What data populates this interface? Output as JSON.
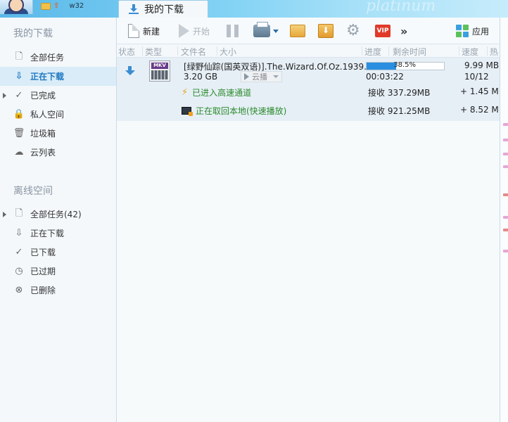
{
  "header": {
    "username": "w32",
    "active_tab": "我的下载",
    "watermark": "platinum"
  },
  "sidebar": {
    "my_downloads_title": "我的下载",
    "my_items": [
      {
        "label": "全部任务",
        "icon": "file-icon"
      },
      {
        "label": "正在下载",
        "icon": "download-icon",
        "active": true
      },
      {
        "label": "已完成",
        "icon": "check-icon",
        "expandable": true
      },
      {
        "label": "私人空间",
        "icon": "lock-icon"
      },
      {
        "label": "垃圾箱",
        "icon": "trash-icon"
      },
      {
        "label": "云列表",
        "icon": "cloud-icon"
      }
    ],
    "offline_title": "离线空间",
    "offline_items": [
      {
        "label": "全部任务(42)",
        "icon": "file-icon",
        "expandable": true
      },
      {
        "label": "正在下载",
        "icon": "download-icon"
      },
      {
        "label": "已下载",
        "icon": "check-icon"
      },
      {
        "label": "已过期",
        "icon": "clock-icon"
      },
      {
        "label": "已删除",
        "icon": "delete-icon"
      }
    ]
  },
  "toolbar": {
    "new_label": "新建",
    "start_label": "开始",
    "apps_label": "应用",
    "vip_label": "VIP"
  },
  "columns": [
    "状态",
    "类型",
    "文件名",
    "大小",
    "进度",
    "剩余时间",
    "速度",
    "热"
  ],
  "task": {
    "name": "[绿野仙踪(国英双语)].The.Wizard.Of.Oz.1939...",
    "size": "3.20 GB",
    "cloud_play_label": "云播",
    "progress_percent": 38.5,
    "progress_text": "38.5%",
    "remaining": "00:03:22",
    "speed": "9.99 MB",
    "peers": "10/12",
    "type_label": "MKV",
    "sub_rows": [
      {
        "label": "已进入高速通道",
        "icon": "lightning-icon",
        "received": "接收 337.29MB",
        "speed": "+ 1.45 M"
      },
      {
        "label": "正在取回本地(快速播放)",
        "icon": "monitor-icon",
        "received": "接收 921.25MB",
        "speed": "+ 8.52 M"
      }
    ]
  },
  "colors": {
    "accent": "#1f78c1",
    "progress": "#2a8fe0",
    "green_text": "#2b8a2b",
    "active_bg": "#d9ecf8"
  }
}
